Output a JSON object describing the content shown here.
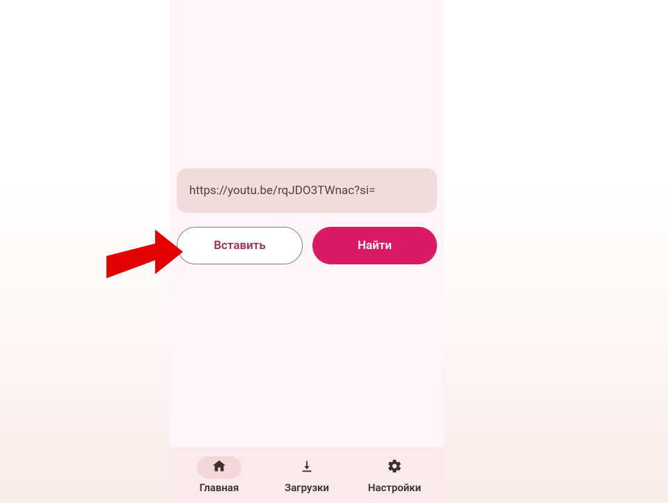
{
  "url_input": {
    "value": "https://youtu.be/rqJDO3TWnac?si="
  },
  "buttons": {
    "paste": "Вставить",
    "find": "Найти"
  },
  "nav": {
    "home": {
      "label": "Главная",
      "active": true
    },
    "downloads": {
      "label": "Загрузки",
      "active": false
    },
    "settings": {
      "label": "Настройки",
      "active": false
    }
  },
  "colors": {
    "accent": "#db1a66",
    "accent_text": "#a03056",
    "arrow": "#e30000"
  }
}
